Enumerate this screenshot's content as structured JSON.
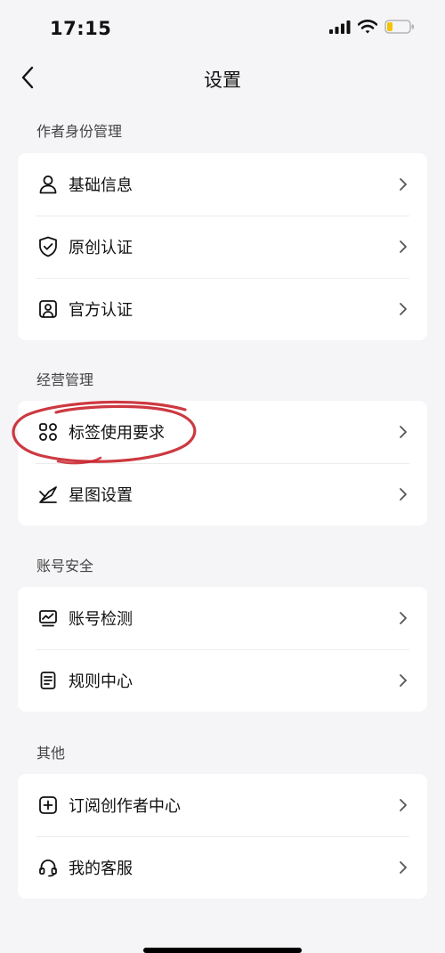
{
  "status": {
    "time": "17:15"
  },
  "nav": {
    "title": "设置"
  },
  "sections": [
    {
      "label": "作者身份管理",
      "items": [
        {
          "label": "基础信息",
          "icon": "user-icon"
        },
        {
          "label": "原创认证",
          "icon": "shield-check-icon"
        },
        {
          "label": "官方认证",
          "icon": "badge-portrait-icon"
        }
      ]
    },
    {
      "label": "经营管理",
      "items": [
        {
          "label": "标签使用要求",
          "icon": "grid-icon"
        },
        {
          "label": "星图设置",
          "icon": "satellite-icon"
        }
      ]
    },
    {
      "label": "账号安全",
      "items": [
        {
          "label": "账号检测",
          "icon": "monitor-chart-icon"
        },
        {
          "label": "规则中心",
          "icon": "document-icon"
        }
      ]
    },
    {
      "label": "其他",
      "items": [
        {
          "label": "订阅创作者中心",
          "icon": "plus-square-icon"
        },
        {
          "label": "我的客服",
          "icon": "headset-icon"
        }
      ]
    }
  ],
  "colors": {
    "annotation": "#c8232c",
    "battery": "#f4c400"
  }
}
